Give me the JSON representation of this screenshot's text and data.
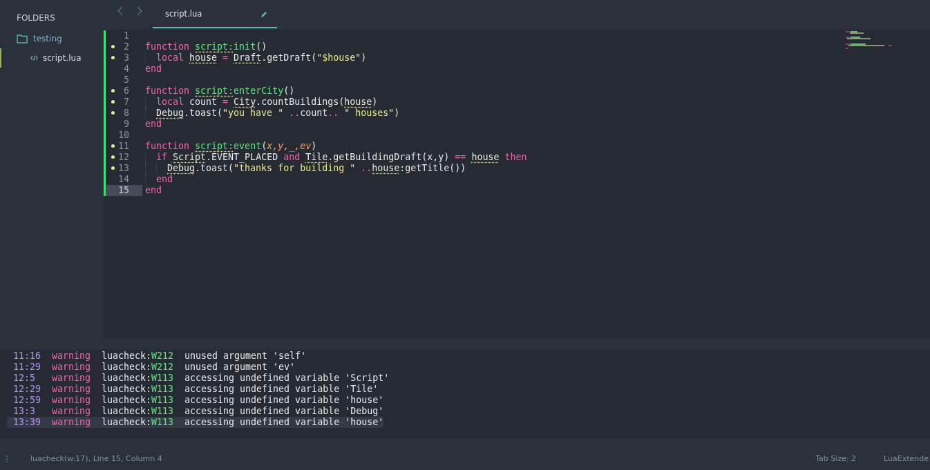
{
  "sidebar": {
    "heading": "FOLDERS",
    "folders": [
      {
        "name": "testing",
        "expanded": true,
        "files": [
          {
            "name": "script.lua",
            "selected": true
          }
        ]
      }
    ]
  },
  "tabs": [
    {
      "label": "script.lua",
      "selected": true,
      "modified": true
    }
  ],
  "editor": {
    "lines": [
      {
        "number": "1",
        "marker": false,
        "current": false,
        "kind": "level0"
      },
      {
        "number": "2",
        "marker": true,
        "current": false,
        "kind": "level0",
        "tokens": [
          {
            "kind": "kw",
            "text": "function "
          },
          {
            "kind": "fnu",
            "text": "script:"
          },
          {
            "kind": "fn",
            "text": "init"
          },
          {
            "kind": "txt",
            "text": "()"
          }
        ]
      },
      {
        "number": "3",
        "marker": true,
        "current": false,
        "kind": "level1",
        "tokens": [
          {
            "kind": "kw",
            "text": "local "
          },
          {
            "kind": "txtu",
            "text": "house"
          },
          {
            "kind": "op",
            "text": " = "
          },
          {
            "kind": "txtu",
            "text": "Draft"
          },
          {
            "kind": "txt",
            "text": ".getDraft("
          },
          {
            "kind": "str",
            "text": "\"$house\""
          },
          {
            "kind": "txt",
            "text": ")"
          }
        ]
      },
      {
        "number": "4",
        "marker": false,
        "current": false,
        "kind": "level0",
        "tokens": [
          {
            "kind": "kw",
            "text": "end"
          }
        ]
      },
      {
        "number": "5",
        "marker": false,
        "current": false,
        "kind": "level0"
      },
      {
        "number": "6",
        "marker": true,
        "current": false,
        "kind": "level0",
        "tokens": [
          {
            "kind": "kw",
            "text": "function "
          },
          {
            "kind": "fnu",
            "text": "script:"
          },
          {
            "kind": "fn",
            "text": "enterCity"
          },
          {
            "kind": "txt",
            "text": "()"
          }
        ]
      },
      {
        "number": "7",
        "marker": true,
        "current": false,
        "kind": "level1",
        "tokens": [
          {
            "kind": "kw",
            "text": "local "
          },
          {
            "kind": "txt",
            "text": "count"
          },
          {
            "kind": "op",
            "text": " = "
          },
          {
            "kind": "txtu",
            "text": "City"
          },
          {
            "kind": "txt",
            "text": ".countBuildings("
          },
          {
            "kind": "txtu",
            "text": "house"
          },
          {
            "kind": "txt",
            "text": ")"
          }
        ]
      },
      {
        "number": "8",
        "marker": true,
        "current": false,
        "kind": "level1",
        "tokens": [
          {
            "kind": "txtu",
            "text": "Debug"
          },
          {
            "kind": "txt",
            "text": ".toast("
          },
          {
            "kind": "str",
            "text": "\"you have \""
          },
          {
            "kind": "op",
            "text": " .."
          },
          {
            "kind": "txt",
            "text": "count"
          },
          {
            "kind": "op",
            "text": ".. "
          },
          {
            "kind": "str",
            "text": "\" houses\""
          },
          {
            "kind": "txt",
            "text": ")"
          }
        ]
      },
      {
        "number": "9",
        "marker": false,
        "current": false,
        "kind": "level0",
        "tokens": [
          {
            "kind": "kw",
            "text": "end"
          }
        ]
      },
      {
        "number": "10",
        "marker": false,
        "current": false,
        "kind": "level0"
      },
      {
        "number": "11",
        "marker": true,
        "current": false,
        "kind": "level0",
        "tokens": [
          {
            "kind": "kw",
            "text": "function "
          },
          {
            "kind": "fnu",
            "text": "script:"
          },
          {
            "kind": "fn",
            "text": "event"
          },
          {
            "kind": "txt",
            "text": "("
          },
          {
            "kind": "param",
            "text": "x,y,_,ev"
          },
          {
            "kind": "txt",
            "text": ")"
          }
        ]
      },
      {
        "number": "12",
        "marker": true,
        "current": false,
        "kind": "level1",
        "tokens": [
          {
            "kind": "kw",
            "text": "if "
          },
          {
            "kind": "txtu",
            "text": "Script"
          },
          {
            "kind": "txt",
            "text": ".EVENT_PLACED "
          },
          {
            "kind": "kw",
            "text": "and "
          },
          {
            "kind": "txtu",
            "text": "Tile"
          },
          {
            "kind": "txt",
            "text": ".getBuildingDraft(x,y)"
          },
          {
            "kind": "op",
            "text": " == "
          },
          {
            "kind": "txtu",
            "text": "house"
          },
          {
            "kind": "kw",
            "text": " then"
          }
        ]
      },
      {
        "number": "13",
        "marker": true,
        "current": false,
        "kind": "level2",
        "tokens": [
          {
            "kind": "txtu",
            "text": "Debug"
          },
          {
            "kind": "txt",
            "text": ".toast("
          },
          {
            "kind": "str",
            "text": "\"thanks for building \""
          },
          {
            "kind": "op",
            "text": " .."
          },
          {
            "kind": "txtu",
            "text": "house"
          },
          {
            "kind": "txt",
            "text": ":getTitle())"
          }
        ]
      },
      {
        "number": "14",
        "marker": false,
        "current": false,
        "kind": "level1",
        "tokens": [
          {
            "kind": "kw",
            "text": "end"
          }
        ]
      },
      {
        "number": "15",
        "marker": false,
        "current": true,
        "kind": "level0",
        "tokens": [
          {
            "kind": "kw",
            "text": "end"
          }
        ]
      }
    ]
  },
  "problems": [
    {
      "position": "11:16",
      "severity": "warning",
      "source": "luacheck:",
      "code": "W212",
      "message": "unused argument 'self'",
      "selected": false
    },
    {
      "position": "11:29",
      "severity": "warning",
      "source": "luacheck:",
      "code": "W212",
      "message": "unused argument 'ev'",
      "selected": false
    },
    {
      "position": "12:5",
      "severity": "warning",
      "source": "luacheck:",
      "code": "W113",
      "message": "accessing undefined variable 'Script'",
      "selected": false
    },
    {
      "position": "12:29",
      "severity": "warning",
      "source": "luacheck:",
      "code": "W113",
      "message": "accessing undefined variable 'Tile'",
      "selected": false
    },
    {
      "position": "12:59",
      "severity": "warning",
      "source": "luacheck:",
      "code": "W113",
      "message": "accessing undefined variable 'house'",
      "selected": false
    },
    {
      "position": "13:3",
      "severity": "warning",
      "source": "luacheck:",
      "code": "W113",
      "message": "accessing undefined variable 'Debug'",
      "selected": false
    },
    {
      "position": "13:39",
      "severity": "warning",
      "source": "luacheck:",
      "code": "W113",
      "message": "accessing undefined variable 'house'",
      "selected": true
    }
  ],
  "status_bar": {
    "left": "luacheck(w:17), Line 15, Column 4",
    "tab_size": "Tab Size: 2",
    "syntax": "LuaExtende"
  }
}
